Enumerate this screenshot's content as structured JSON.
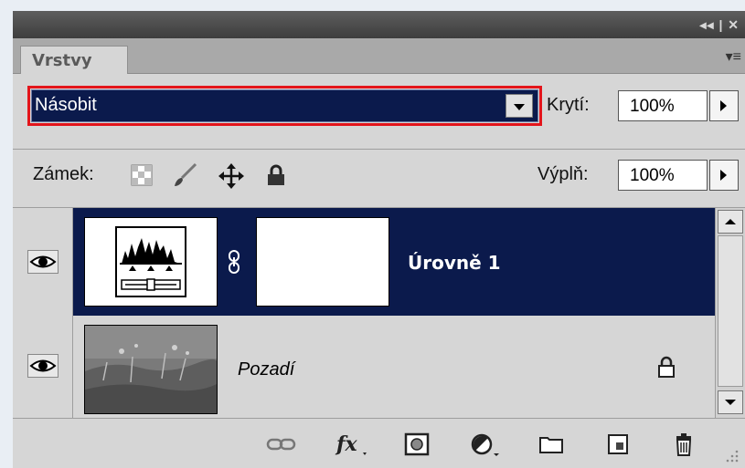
{
  "window": {
    "controls": "◂◂ | ✕"
  },
  "tabs": [
    {
      "label": "Vrstvy"
    }
  ],
  "panel_menu": "▾≡",
  "blend_mode": {
    "value": "Násobit"
  },
  "opacity": {
    "label": "Krytí:",
    "value": "100%"
  },
  "lock": {
    "label": "Zámek:"
  },
  "fill": {
    "label": "Výplň:",
    "value": "100%"
  },
  "layers": [
    {
      "name": "Úrovně 1",
      "selected": true,
      "visible": true
    },
    {
      "name": "Pozadí",
      "selected": false,
      "visible": true,
      "locked": true
    }
  ],
  "colors": {
    "selection": "#0b1a4c",
    "highlight_border": "#e3151b",
    "panel_bg": "#d6d6d6"
  }
}
